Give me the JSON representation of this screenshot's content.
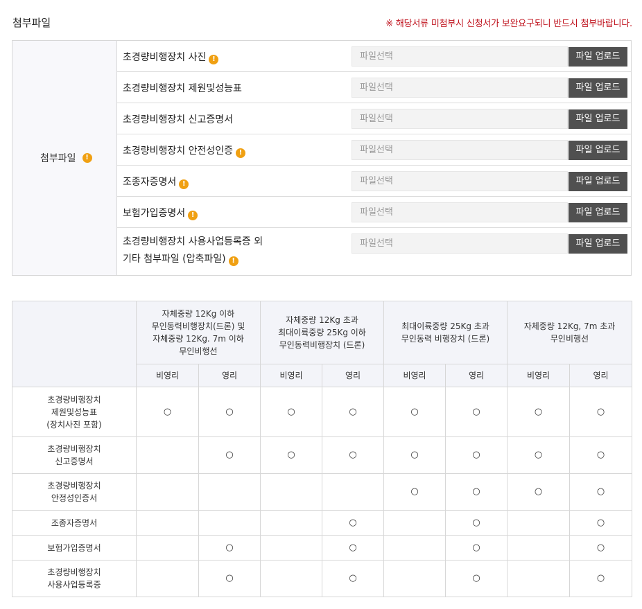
{
  "header": {
    "title": "첨부파일",
    "notice": "※ 해당서류 미첨부시 신청서가 보완요구되니 반드시 첨부바랍니다."
  },
  "attachments": {
    "label": "첨부파일",
    "placeholder": "파일선택",
    "upload_label": "파일 업로드",
    "rows": [
      {
        "label": "초경량비행장치 사진",
        "warn": true
      },
      {
        "label": "초경량비행장치 제원및성능표",
        "warn": false
      },
      {
        "label": "초경량비행장치 신고증명서",
        "warn": false
      },
      {
        "label": "초경량비행장치 안전성인증",
        "warn": true
      },
      {
        "label": "조종자증명서",
        "warn": true
      },
      {
        "label": "보험가입증명서",
        "warn": true
      },
      {
        "label_line1": "초경량비행장치 사용사업등록증 외",
        "label_line2": "기타 첨부파일 (압축파일)",
        "warn": true
      }
    ]
  },
  "matrix": {
    "groups": [
      [
        "자체중량 12Kg 이하",
        "무인동력비행장치(드론) 및",
        "자체중량 12Kg. 7m 이하",
        "무인비행선"
      ],
      [
        "자체중량 12Kg 초과",
        "최대이륙중량 25Kg 이하",
        "무인동력비행장치 (드론)"
      ],
      [
        "최대이륙중량 25Kg 초과",
        "무인동력 비행장치 (드론)"
      ],
      [
        "자체중량 12Kg, 7m 초과",
        "무인비행선"
      ]
    ],
    "subheaders": [
      "비영리",
      "영리",
      "비영리",
      "영리",
      "비영리",
      "영리",
      "비영리",
      "영리"
    ],
    "mark": "○",
    "rows": [
      {
        "label": [
          "초경량비행장치",
          "제원및성능표",
          "(장치사진 포함)"
        ],
        "marks": [
          true,
          true,
          true,
          true,
          true,
          true,
          true,
          true
        ]
      },
      {
        "label": [
          "초경량비행장치",
          "신고증명서"
        ],
        "marks": [
          false,
          true,
          true,
          true,
          true,
          true,
          true,
          true
        ]
      },
      {
        "label": [
          "초경량비행장치",
          "안정성인증서"
        ],
        "marks": [
          false,
          false,
          false,
          false,
          true,
          true,
          true,
          true
        ]
      },
      {
        "label": [
          "조종자증명서"
        ],
        "marks": [
          false,
          false,
          false,
          true,
          false,
          true,
          false,
          true
        ]
      },
      {
        "label": [
          "보험가입증명서"
        ],
        "marks": [
          false,
          true,
          false,
          true,
          false,
          true,
          false,
          true
        ]
      },
      {
        "label": [
          "초경량비행장치",
          "사용사업등록증"
        ],
        "marks": [
          false,
          true,
          false,
          true,
          false,
          true,
          false,
          true
        ]
      }
    ]
  }
}
